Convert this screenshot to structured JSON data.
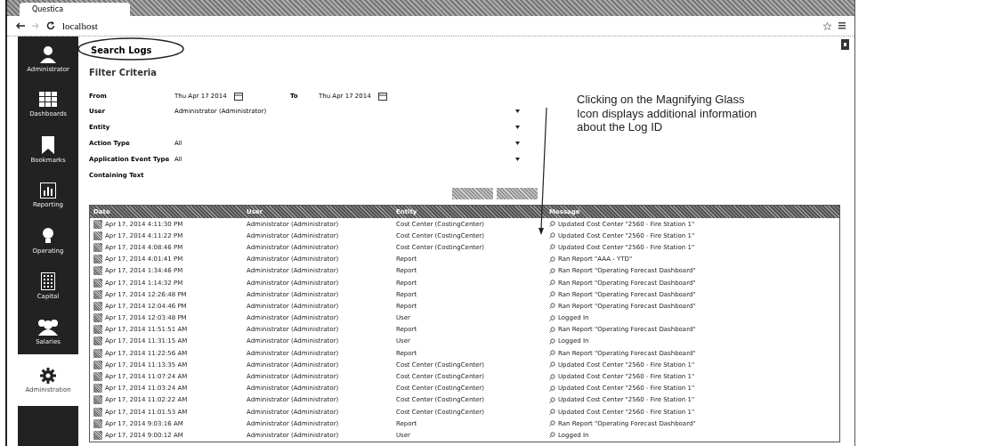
{
  "browser": {
    "tab_title": "Questica",
    "url": "localhost"
  },
  "sidebar": {
    "items": [
      {
        "label": "Administrator",
        "selected": false
      },
      {
        "label": "Dashboards",
        "selected": false
      },
      {
        "label": "Bookmarks",
        "selected": false
      },
      {
        "label": "Reporting",
        "selected": false
      },
      {
        "label": "Operating",
        "selected": false
      },
      {
        "label": "Capital",
        "selected": false
      },
      {
        "label": "Salaries",
        "selected": false
      },
      {
        "label": "Administration",
        "selected": true
      }
    ]
  },
  "page": {
    "title": "Search Logs",
    "section_title": "Filter Criteria"
  },
  "filters": {
    "from": {
      "label": "From",
      "value": "Thu Apr 17 2014"
    },
    "to": {
      "label": "To",
      "value": "Thu Apr 17 2014"
    },
    "fields": [
      {
        "label": "User",
        "value": "Administrator (Administrator)",
        "kind": "select"
      },
      {
        "label": "Entity",
        "kind": "select"
      },
      {
        "label": "Action Type",
        "value": "All",
        "kind": "select"
      },
      {
        "label": "Application Event Type",
        "value": "All",
        "kind": "select"
      },
      {
        "label": "Containing Text",
        "kind": "text"
      }
    ]
  },
  "table": {
    "columns": [
      "Date",
      "User",
      "Entity",
      "Message"
    ],
    "rows": [
      {
        "date": "Apr 17, 2014 4:11:30 PM",
        "user": "Administrator (Administrator)",
        "entity": "Cost Center (CostingCenter)",
        "message": "Updated Cost Center \"2560 - Fire Station 1\""
      },
      {
        "date": "Apr 17, 2014 4:11:22 PM",
        "user": "Administrator (Administrator)",
        "entity": "Cost Center (CostingCenter)",
        "message": "Updated Cost Center \"2560 - Fire Station 1\""
      },
      {
        "date": "Apr 17, 2014 4:08:46 PM",
        "user": "Administrator (Administrator)",
        "entity": "Cost Center (CostingCenter)",
        "message": "Updated Cost Center \"2560 - Fire Station 1\""
      },
      {
        "date": "Apr 17, 2014 4:01:41 PM",
        "user": "Administrator (Administrator)",
        "entity": "Report",
        "message": "Ran Report \"AAA - YTD\""
      },
      {
        "date": "Apr 17, 2014 1:34:46 PM",
        "user": "Administrator (Administrator)",
        "entity": "Report",
        "message": "Ran Report \"Operating Forecast Dashboard\""
      },
      {
        "date": "Apr 17, 2014 1:14:32 PM",
        "user": "Administrator (Administrator)",
        "entity": "Report",
        "message": "Ran Report \"Operating Forecast Dashboard\""
      },
      {
        "date": "Apr 17, 2014 12:26:48 PM",
        "user": "Administrator (Administrator)",
        "entity": "Report",
        "message": "Ran Report \"Operating Forecast Dashboard\""
      },
      {
        "date": "Apr 17, 2014 12:04:46 PM",
        "user": "Administrator (Administrator)",
        "entity": "Report",
        "message": "Ran Report \"Operating Forecast Dashboard\""
      },
      {
        "date": "Apr 17, 2014 12:03:48 PM",
        "user": "Administrator (Administrator)",
        "entity": "User",
        "message": "Logged In"
      },
      {
        "date": "Apr 17, 2014 11:51:51 AM",
        "user": "Administrator (Administrator)",
        "entity": "Report",
        "message": "Ran Report \"Operating Forecast Dashboard\""
      },
      {
        "date": "Apr 17, 2014 11:31:15 AM",
        "user": "Administrator (Administrator)",
        "entity": "User",
        "message": "Logged In"
      },
      {
        "date": "Apr 17, 2014 11:22:56 AM",
        "user": "Administrator (Administrator)",
        "entity": "Report",
        "message": "Ran Report \"Operating Forecast Dashboard\""
      },
      {
        "date": "Apr 17, 2014 11:13:35 AM",
        "user": "Administrator (Administrator)",
        "entity": "Cost Center (CostingCenter)",
        "message": "Updated Cost Center \"2560 - Fire Station 1\""
      },
      {
        "date": "Apr 17, 2014 11:07:24 AM",
        "user": "Administrator (Administrator)",
        "entity": "Cost Center (CostingCenter)",
        "message": "Updated Cost Center \"2560 - Fire Station 1\""
      },
      {
        "date": "Apr 17, 2014 11:03:24 AM",
        "user": "Administrator (Administrator)",
        "entity": "Cost Center (CostingCenter)",
        "message": "Updated Cost Center \"2560 - Fire Station 1\""
      },
      {
        "date": "Apr 17, 2014 11:02:22 AM",
        "user": "Administrator (Administrator)",
        "entity": "Cost Center (CostingCenter)",
        "message": "Updated Cost Center \"2560 - Fire Station 1\""
      },
      {
        "date": "Apr 17, 2014 11:01:53 AM",
        "user": "Administrator (Administrator)",
        "entity": "Cost Center (CostingCenter)",
        "message": "Updated Cost Center \"2560 - Fire Station 1\""
      },
      {
        "date": "Apr 17, 2014 9:03:16 AM",
        "user": "Administrator (Administrator)",
        "entity": "Report",
        "message": "Ran Report \"Operating Forecast Dashboard\""
      },
      {
        "date": "Apr 17, 2014 9:00:12 AM",
        "user": "Administrator (Administrator)",
        "entity": "User",
        "message": "Logged In"
      }
    ]
  },
  "annotation": {
    "text": "Clicking on the Magnifying Glass Icon displays additional information about the Log ID"
  }
}
